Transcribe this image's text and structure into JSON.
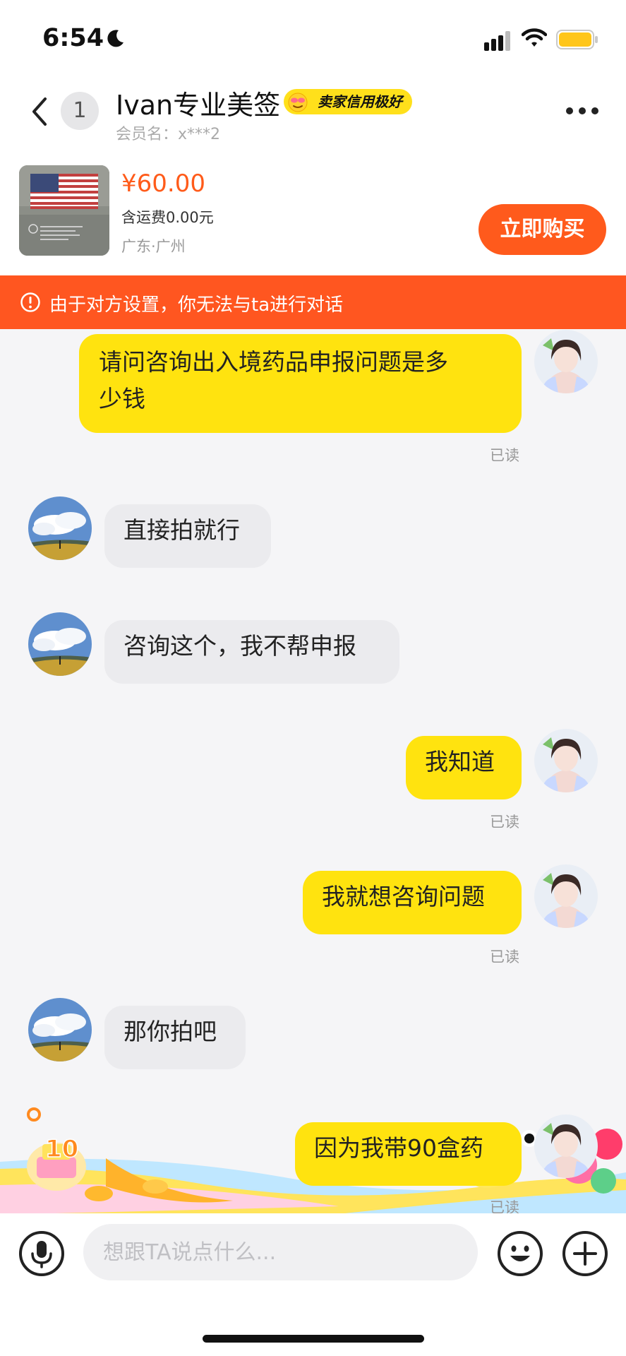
{
  "status": {
    "time": "6:54"
  },
  "header": {
    "unread_count": "1",
    "title": "Ivan专业美签",
    "badge": "卖家信用极好",
    "subtitle": "会员名：x***2"
  },
  "product": {
    "price": "¥60.00",
    "shipping": "含运费0.00元",
    "location": "广东·广州",
    "buy_label": "立即购买"
  },
  "warning": {
    "text": "由于对方设置，你无法与ta进行对话"
  },
  "messages": [
    {
      "sender": "me",
      "lines": [
        "请问咨询出入境药品申报问题是多",
        "少钱"
      ],
      "read": "已读"
    },
    {
      "sender": "them",
      "text": "直接拍就行"
    },
    {
      "sender": "them",
      "text": "咨询这个，我不帮申报"
    },
    {
      "sender": "me",
      "text": "我知道",
      "read": "已读"
    },
    {
      "sender": "me",
      "text": "我就想咨询问题",
      "read": "已读"
    },
    {
      "sender": "them",
      "text": "那你拍吧"
    },
    {
      "sender": "me",
      "text": "因为我带90盒药",
      "read": "已读"
    }
  ],
  "decoration": {
    "number": "10"
  },
  "input": {
    "placeholder": "想跟TA说点什么..."
  },
  "colors": {
    "accent": "#ff5a1c",
    "warning_bg": "#ff5620",
    "my_bubble": "#ffe30f",
    "their_bubble": "#ebebee",
    "badge": "#ffe01b"
  },
  "icons": [
    "moon-icon",
    "signal-icon",
    "wifi-icon",
    "battery-icon",
    "back-icon",
    "more-icon",
    "warning-icon",
    "microphone-icon",
    "emoji-icon",
    "plus-icon"
  ]
}
